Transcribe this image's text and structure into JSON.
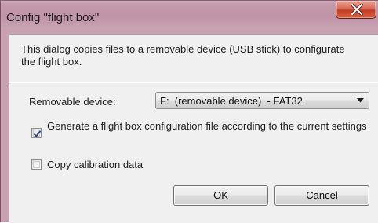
{
  "window": {
    "title": "Config \"flight box\""
  },
  "dialog": {
    "info_text": "This dialog copies files to a removable device (USB stick) to configurate the flight box.",
    "device_label": "Removable device:",
    "device_value": "F:  (removable device)  - FAT32",
    "generate_config": {
      "label": "Generate a flight box configuration file according to the current settings",
      "checked": true
    },
    "copy_calibration": {
      "label": "Copy calibration data",
      "checked": false
    },
    "ok_label": "OK",
    "cancel_label": "Cancel"
  },
  "icons": {
    "close": "close-icon",
    "dropdown": "chevron-down-icon",
    "check": "check-icon"
  },
  "colors": {
    "close_button": "#c43b26",
    "window_frame": "#c39aab",
    "client_background": "#f0f0f0"
  }
}
